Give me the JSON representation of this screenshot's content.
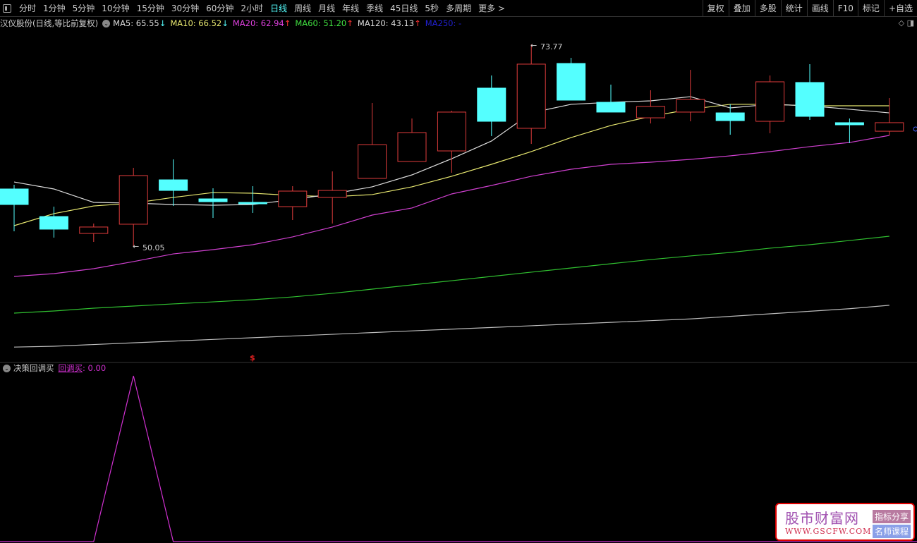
{
  "toolbar": {
    "periods": [
      "分时",
      "1分钟",
      "5分钟",
      "10分钟",
      "15分钟",
      "30分钟",
      "60分钟",
      "2小时",
      "日线",
      "周线",
      "月线",
      "年线",
      "季线",
      "45日线",
      "5秒",
      "多周期",
      "更多 >"
    ],
    "active_index": 8,
    "right_tools": [
      "复权",
      "叠加",
      "多股",
      "统计",
      "画线",
      "F10",
      "标记",
      "+自选"
    ]
  },
  "legend": {
    "title": "汉仪股份(日线,等比前复权)",
    "ma": [
      {
        "label": "MA5: 65.55",
        "arrow": "↓",
        "color": "#dddddd",
        "arrow_color": "#5ff"
      },
      {
        "label": "MA10: 66.52",
        "arrow": "↓",
        "color": "#e8e870",
        "arrow_color": "#5ff"
      },
      {
        "label": "MA20: 62.94",
        "arrow": "↑",
        "color": "#e040e0",
        "arrow_color": "#f33"
      },
      {
        "label": "MA60: 51.20",
        "arrow": "↑",
        "color": "#40e040",
        "arrow_color": "#f33"
      },
      {
        "label": "MA120: 43.13",
        "arrow": "↑",
        "color": "#dddddd",
        "arrow_color": "#f33"
      },
      {
        "label": "MA250: -",
        "arrow": "",
        "color": "#2020d0",
        "arrow_color": "#2020d0"
      }
    ]
  },
  "sub": {
    "title": "决策回调买",
    "indicator": "回调买",
    "value": ": 0.00"
  },
  "annotations": {
    "high": "73.77",
    "low": "50.05",
    "marker": "$"
  },
  "logo": {
    "name": "股市财富网",
    "url": "WWW.GSCFW.COM",
    "tag1": "指标分享",
    "tag2": "名师课程"
  },
  "colors": {
    "up": "#e03c3c",
    "down": "#54ffff",
    "ma5": "#dddddd",
    "ma10": "#e8e870",
    "ma20": "#d040d0",
    "ma60": "#30c030",
    "ma120": "#bbbbbb",
    "sub": "#d030d0"
  },
  "chart_data": {
    "type": "candlestick",
    "candles": [
      [
        56.83,
        57.32,
        51.87,
        55.01
      ],
      [
        53.6,
        54.76,
        51.13,
        52.12
      ],
      [
        51.62,
        52.78,
        50.63,
        52.37
      ],
      [
        52.7,
        59.31,
        50.05,
        58.4
      ],
      [
        57.9,
        60.3,
        54.84,
        56.66
      ],
      [
        55.67,
        56.91,
        53.44,
        55.34
      ],
      [
        55.26,
        57.16,
        54.02,
        55.09
      ],
      [
        54.76,
        57.16,
        53.19,
        56.58
      ],
      [
        55.84,
        58.89,
        52.78,
        56.66
      ],
      [
        58.07,
        66.91,
        58.07,
        62.03
      ],
      [
        60.05,
        65.09,
        60.05,
        63.44
      ],
      [
        61.29,
        66.0,
        58.73,
        65.84
      ],
      [
        68.65,
        70.13,
        63.03,
        64.76
      ],
      [
        63.94,
        73.77,
        62.12,
        71.46
      ],
      [
        71.54,
        72.2,
        67.24,
        67.24
      ],
      [
        66.99,
        69.06,
        65.84,
        65.84
      ],
      [
        65.17,
        68.4,
        64.51,
        66.5
      ],
      [
        65.84,
        70.79,
        64.76,
        67.32
      ],
      [
        65.75,
        66.75,
        63.19,
        64.84
      ],
      [
        64.76,
        70.13,
        63.36,
        69.39
      ],
      [
        69.31,
        71.46,
        64.93,
        65.34
      ],
      [
        64.6,
        65.09,
        62.2,
        64.35
      ],
      [
        63.6,
        67.49,
        63.11,
        64.6
      ]
    ],
    "ohlc_order": [
      "open",
      "high",
      "low",
      "close"
    ],
    "ma5": [
      57.65,
      56.83,
      55.26,
      55.17,
      55.01,
      54.93,
      55.01,
      55.59,
      56.25,
      57.08,
      58.48,
      60.38,
      62.45,
      65.75,
      66.75,
      66.99,
      67.16,
      67.65,
      66.33,
      66.75,
      66.58,
      66.17,
      65.75
    ],
    "ma10": [
      52.53,
      53.94,
      54.84,
      55.17,
      55.84,
      56.41,
      56.33,
      56.08,
      55.92,
      56.17,
      57.08,
      58.32,
      59.72,
      61.21,
      62.86,
      64.27,
      65.34,
      66.17,
      66.75,
      66.75,
      66.58,
      66.58,
      66.58
    ],
    "ma20": [
      46.58,
      46.91,
      47.49,
      48.32,
      49.22,
      49.72,
      50.3,
      51.21,
      52.37,
      53.77,
      54.6,
      56.25,
      57.24,
      58.32,
      59.14,
      59.72,
      59.97,
      60.3,
      60.71,
      61.21,
      61.79,
      62.28,
      63.11
    ],
    "ma60": [
      42.28,
      42.53,
      42.86,
      43.11,
      43.36,
      43.6,
      43.85,
      44.18,
      44.6,
      45.09,
      45.59,
      46.08,
      46.58,
      47.08,
      47.57,
      48.07,
      48.56,
      48.98,
      49.39,
      49.89,
      50.3,
      50.79,
      51.29
    ],
    "ma120": [
      38.3,
      38.4,
      38.6,
      38.8,
      39.0,
      39.2,
      39.4,
      39.6,
      39.8,
      40.0,
      40.2,
      40.4,
      40.6,
      40.8,
      41.0,
      41.2,
      41.4,
      41.6,
      41.9,
      42.2,
      42.5,
      42.8,
      43.2
    ],
    "sub_values": [
      0,
      0,
      0,
      1,
      0,
      0,
      0,
      0,
      0,
      0,
      0,
      0,
      0,
      0,
      0,
      0,
      0,
      0,
      0,
      0,
      0,
      0,
      0
    ],
    "marker_index": 6
  }
}
